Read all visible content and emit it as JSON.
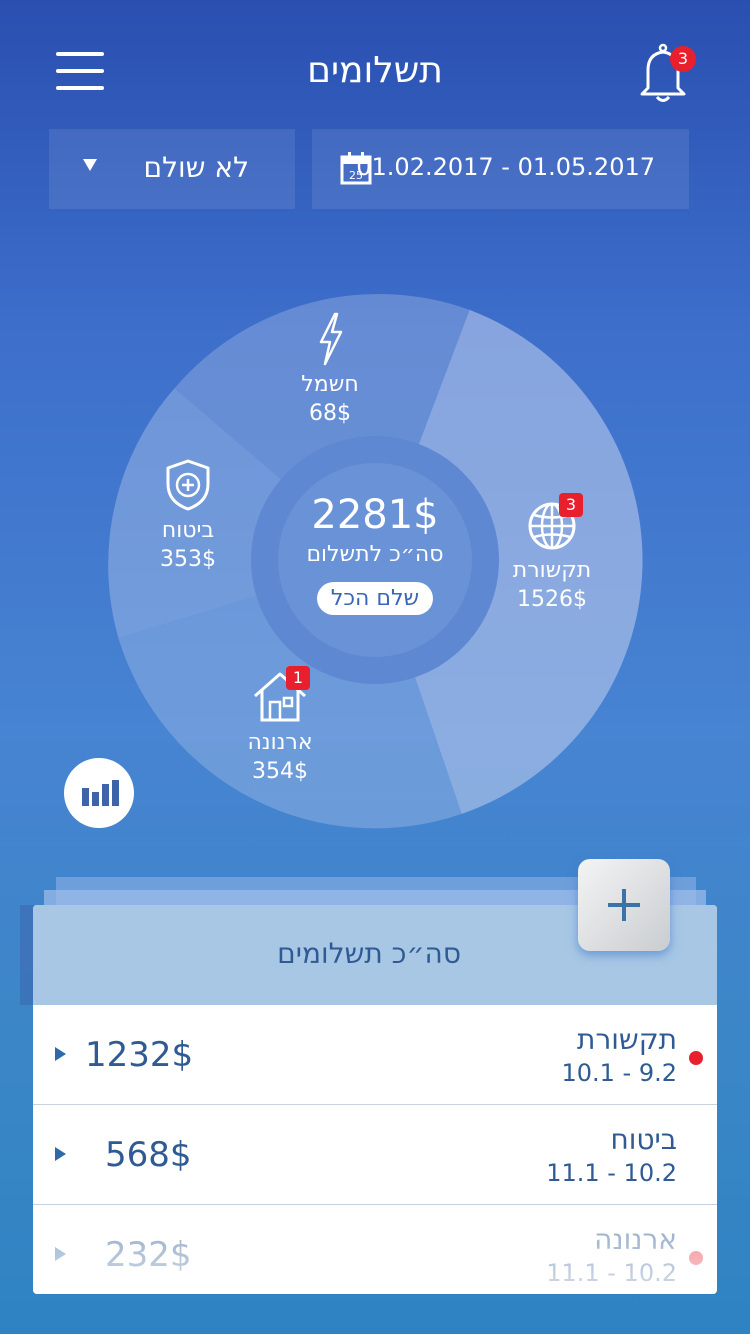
{
  "header": {
    "title": "תשלומים",
    "notifications_count": "3"
  },
  "filters": {
    "status_label": "לא שולם",
    "date_range": "01.02.2017 - 01.05.2017",
    "calendar_day": "25"
  },
  "summary": {
    "total": "2281$",
    "total_label": "סה״כ לתשלום",
    "pay_all_label": "שלם הכל"
  },
  "segments": [
    {
      "label": "חשמל",
      "amount": "68$",
      "icon": "lightning-icon",
      "badge": ""
    },
    {
      "label": "תקשורת",
      "amount": "1526$",
      "icon": "globe-icon",
      "badge": "3"
    },
    {
      "label": "ארנונה",
      "amount": "354$",
      "icon": "house-icon",
      "badge": "1"
    },
    {
      "label": "ביטוח",
      "amount": "353$",
      "icon": "shield-plus-icon",
      "badge": ""
    }
  ],
  "list": {
    "title": "סה״כ תשלומים",
    "rows": [
      {
        "name": "תקשורת",
        "range": "10.1 - 9.2",
        "amount": "1232$",
        "unread": true
      },
      {
        "name": "ביטוח",
        "range": "11.1 - 10.2",
        "amount": "568$",
        "unread": false
      },
      {
        "name": "ארנונה",
        "range": "11.1 - 10.2",
        "amount": "232$",
        "unread": true
      }
    ]
  },
  "colors": {
    "accent": "#2f5a93",
    "badge": "#e8202e"
  }
}
